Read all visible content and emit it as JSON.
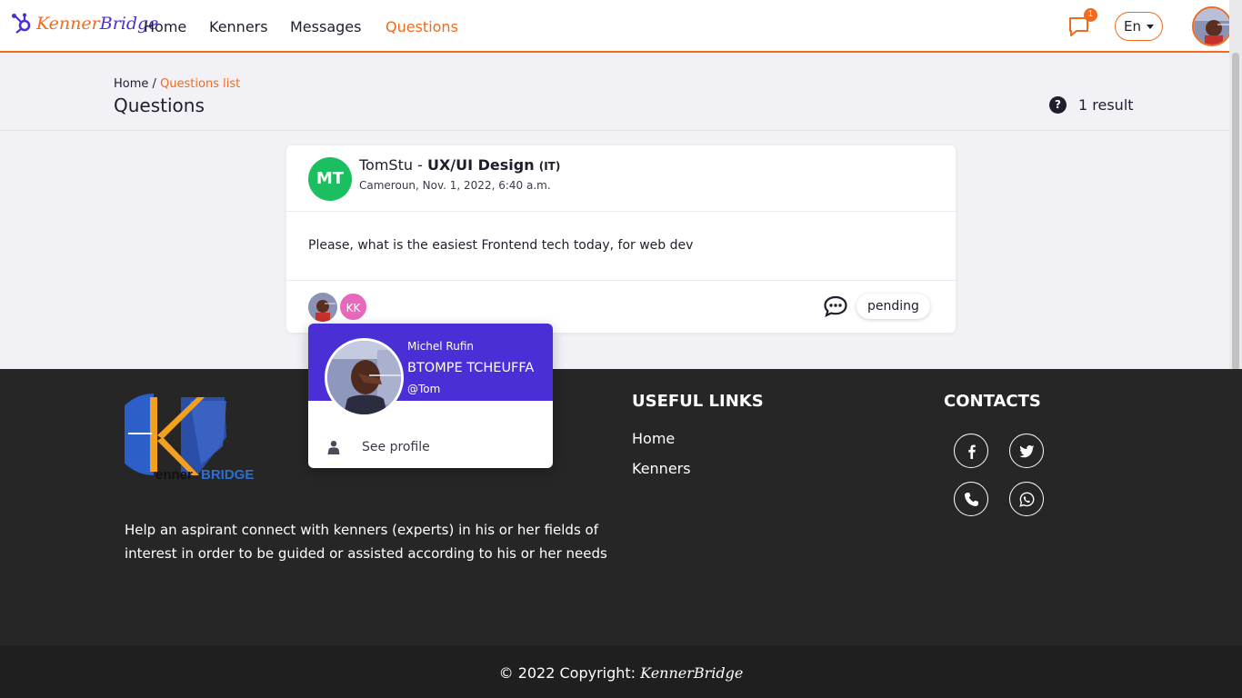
{
  "nav": {
    "brand_part1": "Kenner",
    "brand_part2": "Bridge",
    "links": [
      "Home",
      "Kenners",
      "Messages",
      "Questions"
    ],
    "active_link": "Questions",
    "notification_count": "1",
    "language": "En"
  },
  "header": {
    "breadcrumb_home": "Home",
    "breadcrumb_sep": "/",
    "breadcrumb_current": "Questions list",
    "title": "Questions",
    "result_count": "1 result",
    "result_icon": "?"
  },
  "question": {
    "avatar_initials": "MT",
    "author": "TomStu",
    "separator": " - ",
    "domain": "UX/UI Design",
    "category": "(IT)",
    "meta": "Cameroun, Nov. 1, 2022, 6:40 a.m.",
    "body": "Please, what is the easiest Frontend tech today, for web dev",
    "participant_initials": "KK",
    "status": "pending"
  },
  "popover": {
    "first_name": "Michel Rufin",
    "last_name": "BTOMPE TCHEUFFA",
    "handle": "@Tom",
    "action_label": "See profile"
  },
  "footer": {
    "about": "Help an aspirant connect with kenners (experts) in his or her fields of interest in order to be guided or assisted according to his or her needs",
    "useful_links_title": "USEFUL LINKS",
    "useful_links": [
      "Home",
      "Kenners"
    ],
    "contacts_title": "CONTACTS",
    "logo_word1": "enner",
    "logo_word2": "BRIDGE",
    "copyright_prefix": "© 2022 Copyright:",
    "copyright_brand": "KennerBridge"
  },
  "colors": {
    "accent": "#f26a1b",
    "brand_purple": "#4a2fd6",
    "avatar_green": "#1cbf5f",
    "avatar_pink": "#e868bc",
    "footer_bg": "#262626"
  }
}
